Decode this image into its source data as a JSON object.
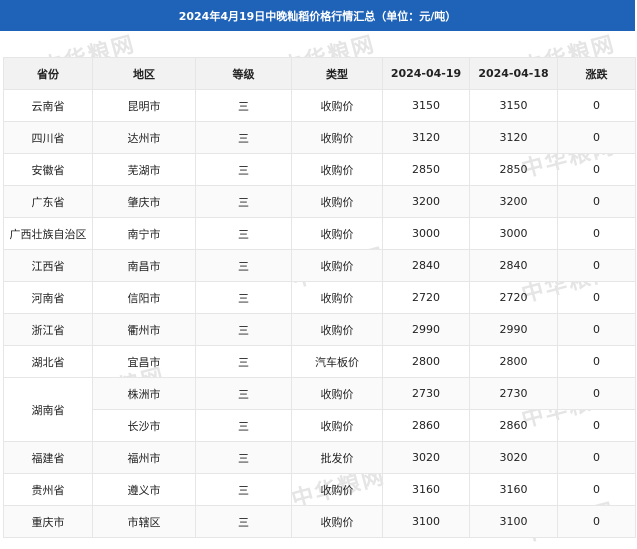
{
  "title": "2024年4月19日中晚籼稻价格行情汇总（单位：元/吨）",
  "watermark": "中华粮网",
  "columns": [
    "省份",
    "地区",
    "等级",
    "类型",
    "2024-04-19",
    "2024-04-18",
    "涨跌"
  ],
  "rows": [
    {
      "province": "云南省",
      "region": "昆明市",
      "grade": "三",
      "type": "收购价",
      "price_today": "3150",
      "price_prev": "3150",
      "change": "0"
    },
    {
      "province": "四川省",
      "region": "达州市",
      "grade": "三",
      "type": "收购价",
      "price_today": "3120",
      "price_prev": "3120",
      "change": "0"
    },
    {
      "province": "安徽省",
      "region": "芜湖市",
      "grade": "三",
      "type": "收购价",
      "price_today": "2850",
      "price_prev": "2850",
      "change": "0"
    },
    {
      "province": "广东省",
      "region": "肇庆市",
      "grade": "三",
      "type": "收购价",
      "price_today": "3200",
      "price_prev": "3200",
      "change": "0"
    },
    {
      "province": "广西壮族自治区",
      "region": "南宁市",
      "grade": "三",
      "type": "收购价",
      "price_today": "3000",
      "price_prev": "3000",
      "change": "0"
    },
    {
      "province": "江西省",
      "region": "南昌市",
      "grade": "三",
      "type": "收购价",
      "price_today": "2840",
      "price_prev": "2840",
      "change": "0"
    },
    {
      "province": "河南省",
      "region": "信阳市",
      "grade": "三",
      "type": "收购价",
      "price_today": "2720",
      "price_prev": "2720",
      "change": "0"
    },
    {
      "province": "浙江省",
      "region": "衢州市",
      "grade": "三",
      "type": "收购价",
      "price_today": "2990",
      "price_prev": "2990",
      "change": "0"
    },
    {
      "province": "湖北省",
      "region": "宜昌市",
      "grade": "三",
      "type": "汽车板价",
      "price_today": "2800",
      "price_prev": "2800",
      "change": "0"
    },
    {
      "province": "湖南省",
      "region": "株洲市",
      "grade": "三",
      "type": "收购价",
      "price_today": "2730",
      "price_prev": "2730",
      "change": "0"
    },
    {
      "province": "",
      "region": "长沙市",
      "grade": "三",
      "type": "收购价",
      "price_today": "2860",
      "price_prev": "2860",
      "change": "0"
    },
    {
      "province": "福建省",
      "region": "福州市",
      "grade": "三",
      "type": "批发价",
      "price_today": "3020",
      "price_prev": "3020",
      "change": "0"
    },
    {
      "province": "贵州省",
      "region": "遵义市",
      "grade": "三",
      "type": "收购价",
      "price_today": "3160",
      "price_prev": "3160",
      "change": "0"
    },
    {
      "province": "重庆市",
      "region": "市辖区",
      "grade": "三",
      "type": "收购价",
      "price_today": "3100",
      "price_prev": "3100",
      "change": "0"
    }
  ]
}
